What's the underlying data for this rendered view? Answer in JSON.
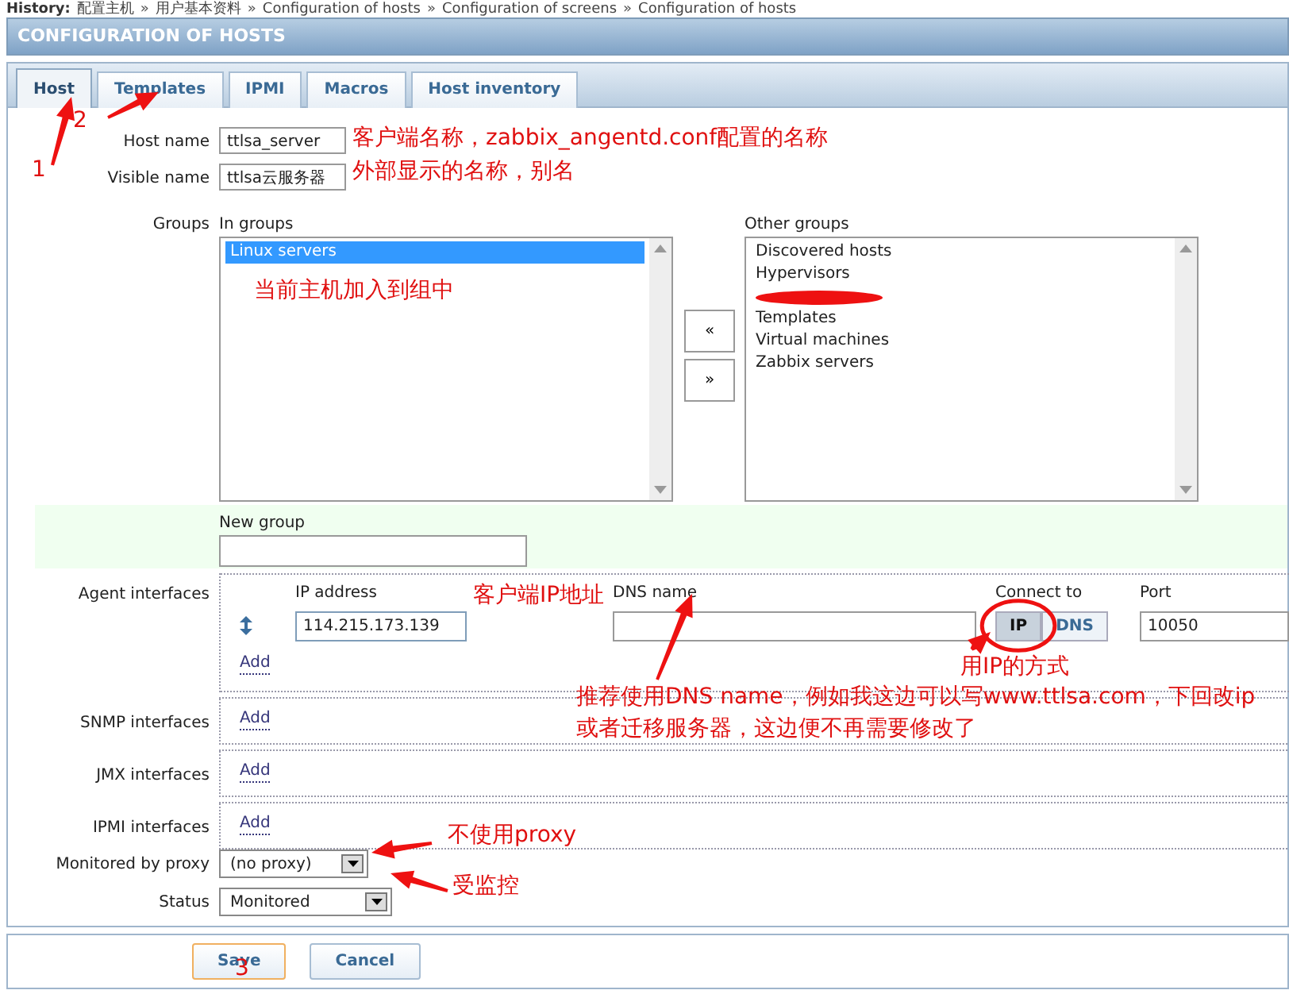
{
  "history": {
    "label": "History:",
    "separator": "»",
    "items": [
      "配置主机",
      "用户基本资料",
      "Configuration of hosts",
      "Configuration of screens",
      "Configuration of hosts"
    ]
  },
  "header": {
    "title": "CONFIGURATION OF HOSTS"
  },
  "tabs": [
    {
      "label": "Host",
      "selected": true
    },
    {
      "label": "Templates",
      "selected": false
    },
    {
      "label": "IPMI",
      "selected": false
    },
    {
      "label": "Macros",
      "selected": false
    },
    {
      "label": "Host inventory",
      "selected": false
    }
  ],
  "form": {
    "host_name": {
      "label": "Host name",
      "value": "ttlsa_server"
    },
    "visible_name": {
      "label": "Visible name",
      "value": "ttlsa云服务器"
    },
    "groups": {
      "label": "Groups",
      "in_label": "In groups",
      "in_items": [
        {
          "label": "Linux servers",
          "selected": true
        }
      ],
      "other_label": "Other groups",
      "other_items": [
        {
          "kind": "text",
          "label": "Discovered hosts",
          "selected": false
        },
        {
          "kind": "text",
          "label": "Hypervisors",
          "selected": false
        },
        {
          "kind": "redacted",
          "selected": false
        },
        {
          "kind": "text",
          "label": "Templates",
          "selected": false
        },
        {
          "kind": "text",
          "label": "Virtual machines",
          "selected": false
        },
        {
          "kind": "text",
          "label": "Zabbix servers",
          "selected": false
        }
      ],
      "move_buttons": [
        "«",
        "»"
      ]
    },
    "new_group": {
      "label": "New group"
    },
    "interfaces": [
      {
        "kind": "agent",
        "label": "Agent interfaces",
        "columns": [
          "IP address",
          "DNS name",
          "Connect to",
          "Port"
        ],
        "rows": [
          {
            "ip": "114.215.173.139",
            "connect": [
              {
                "label": "IP",
                "selected": true
              },
              {
                "label": "DNS",
                "selected": false
              }
            ],
            "port": "10050"
          }
        ],
        "add": "Add"
      },
      {
        "kind": "simple",
        "label": "SNMP interfaces",
        "add": "Add"
      },
      {
        "kind": "simple",
        "label": "JMX interfaces",
        "add": "Add"
      },
      {
        "kind": "simple",
        "label": "IPMI interfaces",
        "add": "Add"
      }
    ],
    "proxy": {
      "label": "Monitored by proxy",
      "value": "(no proxy)"
    },
    "status": {
      "label": "Status",
      "value": "Monitored"
    }
  },
  "buttons": [
    {
      "label": "Save",
      "focused": true
    },
    {
      "label": "Cancel",
      "focused": false
    }
  ],
  "annotations": [
    {
      "kind": "number",
      "text": "1"
    },
    {
      "kind": "number",
      "text": "2"
    },
    {
      "kind": "note",
      "text": "客户端名称，zabbix_angentd.conf配置的名称"
    },
    {
      "kind": "note",
      "text": "外部显示的名称，别名"
    },
    {
      "kind": "note",
      "text": "当前主机加入到组中"
    },
    {
      "kind": "note",
      "text": "客户端IP地址"
    },
    {
      "kind": "note",
      "text": "用IP的方式"
    },
    {
      "kind": "note",
      "text": "推荐使用DNS name，例如我这边可以写www.ttlsa.com，下回改ip"
    },
    {
      "kind": "note",
      "text": "或者迁移服务器，这边便不再需要修改了"
    },
    {
      "kind": "note",
      "text": "不使用proxy"
    },
    {
      "kind": "note",
      "text": "受监控"
    },
    {
      "kind": "number",
      "text": "3"
    }
  ]
}
